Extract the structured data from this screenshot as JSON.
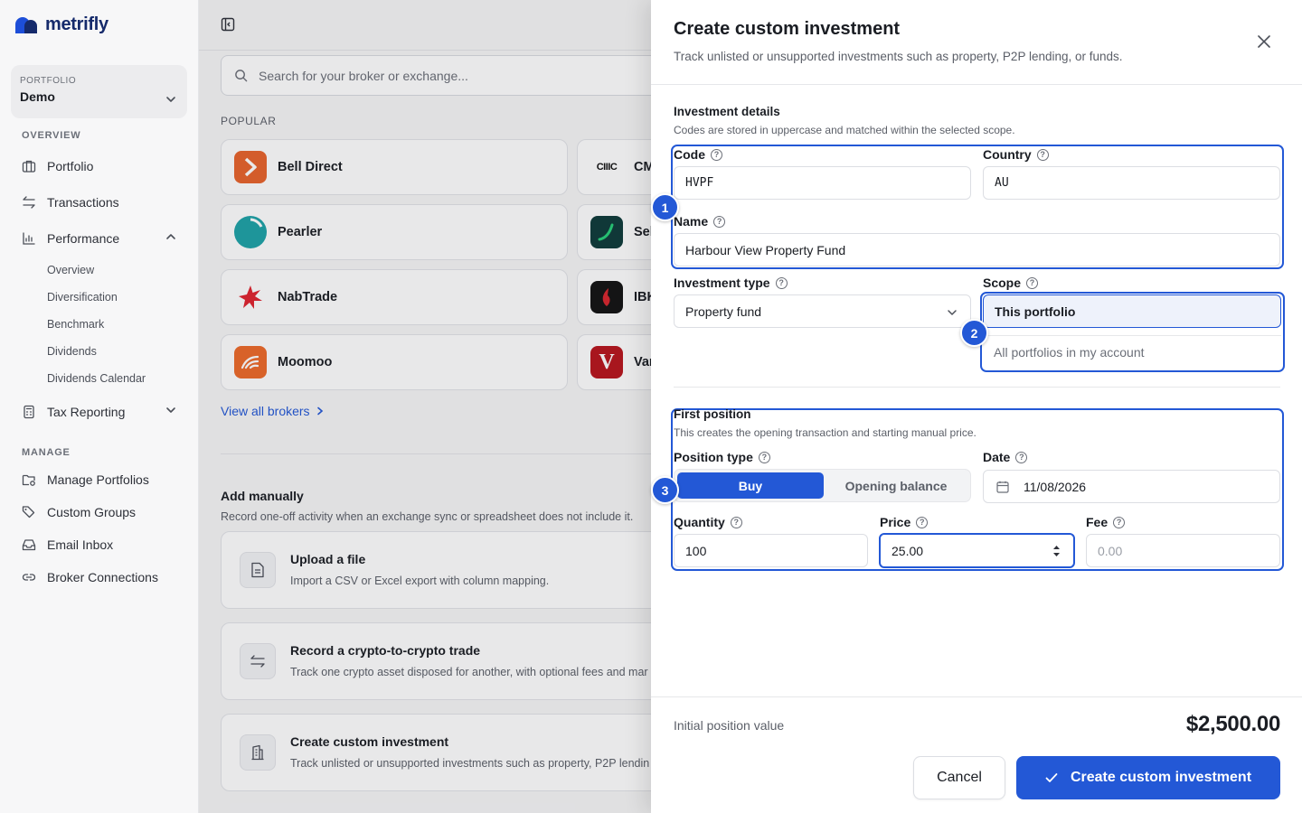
{
  "app": {
    "name": "metrifly"
  },
  "sidebar": {
    "portfolio_label": "PORTFOLIO",
    "portfolio_value": "Demo",
    "overview_label": "OVERVIEW",
    "manage_label": "MANAGE",
    "items": [
      {
        "label": "Portfolio",
        "icon": "briefcase-icon"
      },
      {
        "label": "Transactions",
        "icon": "arrows-swap-icon"
      },
      {
        "label": "Performance",
        "icon": "bar-chart-icon"
      },
      {
        "label": "Tax Reporting",
        "icon": "calculator-icon"
      }
    ],
    "performance_sub": [
      "Overview",
      "Diversification",
      "Benchmark",
      "Dividends",
      "Dividends Calendar"
    ],
    "manage_items": [
      {
        "label": "Manage Portfolios",
        "icon": "folder-settings-icon"
      },
      {
        "label": "Custom Groups",
        "icon": "tags-icon"
      },
      {
        "label": "Email Inbox",
        "icon": "inbox-icon"
      },
      {
        "label": "Broker Connections",
        "icon": "link-icon"
      }
    ]
  },
  "main": {
    "search_placeholder": "Search for your broker or exchange...",
    "popular_label": "POPULAR",
    "brokers": [
      {
        "name": "Bell Direct",
        "color": "#e8642c"
      },
      {
        "name": "CMC Markets",
        "display": "CM",
        "logo_text": "CIIIC",
        "color": "#ffffff"
      },
      {
        "name": "Pearler",
        "color": "#1fa3a8"
      },
      {
        "name": "Selfwealth",
        "display": "Sel",
        "color": "#0f3b3a"
      },
      {
        "name": "NabTrade",
        "color": "#e0242f"
      },
      {
        "name": "IBKR",
        "display": "IBK",
        "color": "#141414"
      },
      {
        "name": "Moomoo",
        "color": "#ee6a2a"
      },
      {
        "name": "Vanguard",
        "display": "Var",
        "logo_text": "V",
        "color": "#b8161e"
      }
    ],
    "view_all": "View all brokers",
    "add_title": "Add manually",
    "add_sub": "Record one-off activity when an exchange sync or spreadsheet does not include it.",
    "actions": [
      {
        "title": "Upload a file",
        "sub": "Import a CSV or Excel export with column mapping."
      },
      {
        "title": "Record a crypto-to-crypto trade",
        "sub": "Track one crypto asset disposed for another, with optional fees and mar"
      },
      {
        "title": "Create custom investment",
        "sub": "Track unlisted or unsupported investments such as property, P2P lendin"
      }
    ]
  },
  "drawer": {
    "title": "Create custom investment",
    "subtitle": "Track unlisted or unsupported investments such as property, P2P lending, or funds.",
    "details_title": "Investment details",
    "details_sub": "Codes are stored in uppercase and matched within the selected scope.",
    "code_label": "Code",
    "code_value": "HVPF",
    "country_label": "Country",
    "country_value": "AU",
    "name_label": "Name",
    "name_value": "Harbour View Property Fund",
    "type_label": "Investment type",
    "type_value": "Property fund",
    "scope_label": "Scope",
    "scope_options": [
      "This portfolio",
      "All portfolios in my account"
    ],
    "scope_selected": "This portfolio",
    "first_title": "First position",
    "first_sub": "This creates the opening transaction and starting manual price.",
    "position_type_label": "Position type",
    "position_types": [
      "Buy",
      "Opening balance"
    ],
    "position_type_selected": "Buy",
    "date_label": "Date",
    "date_value": "11/08/2026",
    "quantity_label": "Quantity",
    "quantity_value": "100",
    "price_label": "Price",
    "price_value": "25.00",
    "fee_label": "Fee",
    "fee_placeholder": "0.00",
    "badges": [
      "1",
      "2",
      "3"
    ],
    "initial_label": "Initial position value",
    "initial_value": "$2,500.00",
    "cancel_label": "Cancel",
    "create_label": "Create custom investment",
    "accent_color": "#2358d6"
  }
}
